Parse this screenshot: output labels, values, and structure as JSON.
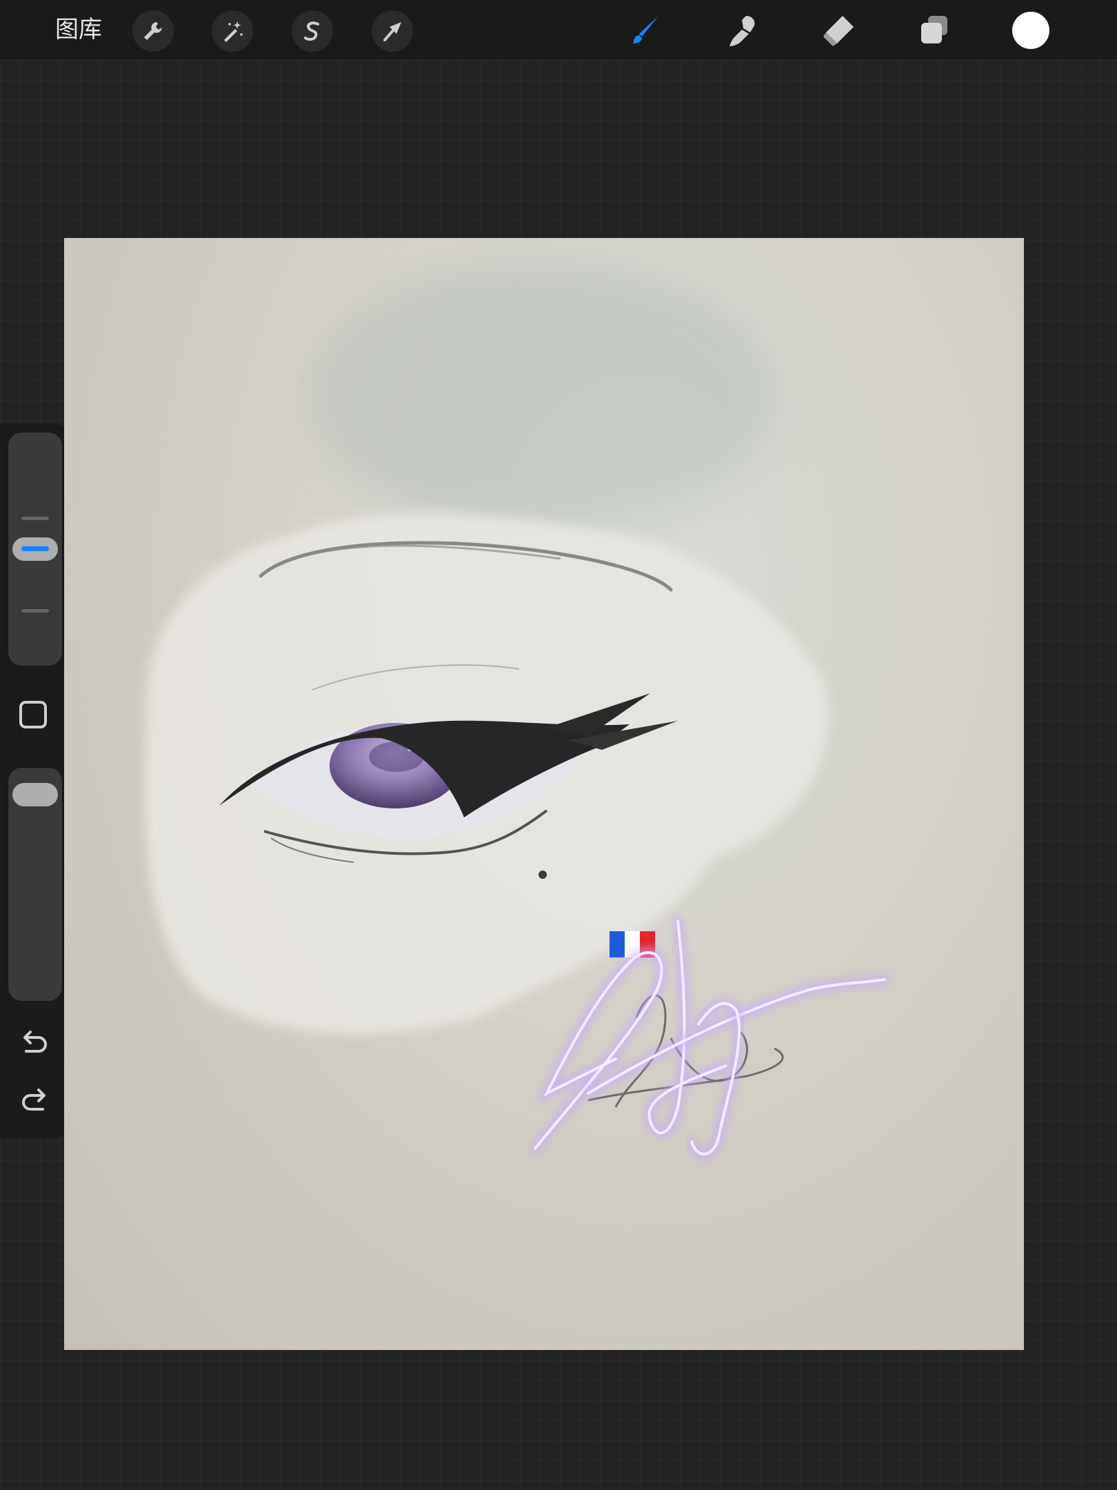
{
  "toolbar": {
    "gallery_label": "图库",
    "left_tools": [
      "wrench-icon",
      "magic-wand-icon",
      "selection-s-icon",
      "transform-arrow-icon"
    ],
    "right_tools": [
      "brush-icon",
      "smudge-icon",
      "eraser-icon",
      "layers-icon"
    ],
    "active_tool": "brush-icon",
    "accent_color": "#1a84ff",
    "current_color": "#ffffff"
  },
  "sidebar": {
    "brush_size_level": 0.5,
    "opacity_level": 0.05,
    "buttons": [
      "modify-square-icon",
      "undo-icon",
      "redo-icon"
    ]
  },
  "canvas": {
    "paper_color": "#d2cfc6",
    "iris_color": "#8d79b2",
    "signature_glow_color": "#c9a8ff",
    "flag_colors": [
      "#1f5bd8",
      "#ffffff",
      "#e3262f"
    ]
  }
}
